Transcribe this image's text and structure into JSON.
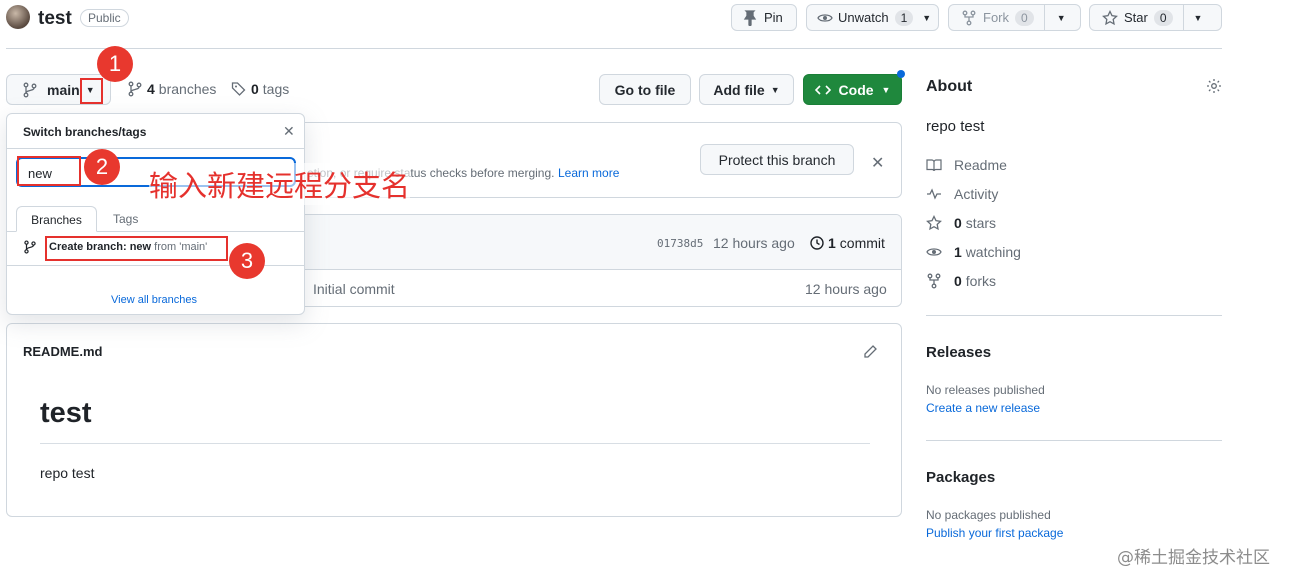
{
  "repo": {
    "name": "test",
    "visibility": "Public"
  },
  "actions": {
    "pin": "Pin",
    "unwatch": "Unwatch",
    "watch_count": "1",
    "fork": "Fork",
    "fork_count": "0",
    "star": "Star",
    "star_count": "0"
  },
  "toolbar": {
    "branch": "main",
    "branches_count": "4",
    "branches_label": "branches",
    "tags_count": "0",
    "tags_label": "tags",
    "go_to_file": "Go to file",
    "add_file": "Add file",
    "code": "Code"
  },
  "dropdown": {
    "title": "Switch branches/tags",
    "input_value": "new",
    "tabs": [
      "Branches",
      "Tags"
    ],
    "create_prefix": "Create branch: ",
    "create_name": "new",
    "create_suffix": " from 'main'",
    "view_all": "View all branches"
  },
  "banner": {
    "partial_text": "etion, or require status checks before merging.",
    "learn_more": "Learn more",
    "protect_button": "Protect this branch"
  },
  "commit_bar": {
    "sha": "01738d5",
    "time": "12 hours ago",
    "count": "1",
    "label": "commit"
  },
  "file_row": {
    "message": "Initial commit",
    "time": "12 hours ago"
  },
  "readme": {
    "filename": "README.md",
    "heading": "test",
    "body": "repo test"
  },
  "about": {
    "title": "About",
    "description": "repo test",
    "readme": "Readme",
    "activity": "Activity",
    "stars_count": "0",
    "stars_label": "stars",
    "watching_count": "1",
    "watching_label": "watching",
    "forks_count": "0",
    "forks_label": "forks"
  },
  "releases": {
    "title": "Releases",
    "none": "No releases published",
    "create": "Create a new release"
  },
  "packages": {
    "title": "Packages",
    "none": "No packages published",
    "publish": "Publish your first package"
  },
  "annotations": {
    "step1": "1",
    "step2": "2",
    "step3": "3",
    "instruction": "输入新建远程分支名",
    "watermark": "@稀土掘金技术社区"
  },
  "colors": {
    "accent_red": "#e5312d",
    "code_green": "#1f883d",
    "link_blue": "#0969da"
  }
}
